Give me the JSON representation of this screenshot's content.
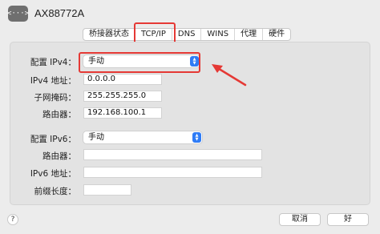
{
  "header": {
    "icon": "ellipsis-network-adapter-icon",
    "icon_glyph": "<···>",
    "title": "AX88772A"
  },
  "tabs": [
    {
      "label": "桥接器状态",
      "active": false
    },
    {
      "label": "TCP/IP",
      "active": true
    },
    {
      "label": "DNS",
      "active": false
    },
    {
      "label": "WINS",
      "active": false
    },
    {
      "label": "代理",
      "active": false
    },
    {
      "label": "硬件",
      "active": false
    }
  ],
  "ipv4": {
    "configure_label": "配置 IPv4：",
    "configure_value": "手动",
    "address_label": "IPv4 地址：",
    "address_value": "0.0.0.0",
    "subnet_label": "子网掩码：",
    "subnet_value": "255.255.255.0",
    "router_label": "路由器：",
    "router_value": "192.168.100.1"
  },
  "ipv6": {
    "configure_label": "配置 IPv6：",
    "configure_value": "手动",
    "router_label": "路由器：",
    "router_value": "",
    "address_label": "IPv6 地址：",
    "address_value": "",
    "prefix_label": "前缀长度：",
    "prefix_value": ""
  },
  "footer": {
    "help_label": "?",
    "cancel_label": "取消",
    "ok_label": "好"
  },
  "colors": {
    "highlight": "#e53935",
    "stepper": "#2f7cf6"
  }
}
